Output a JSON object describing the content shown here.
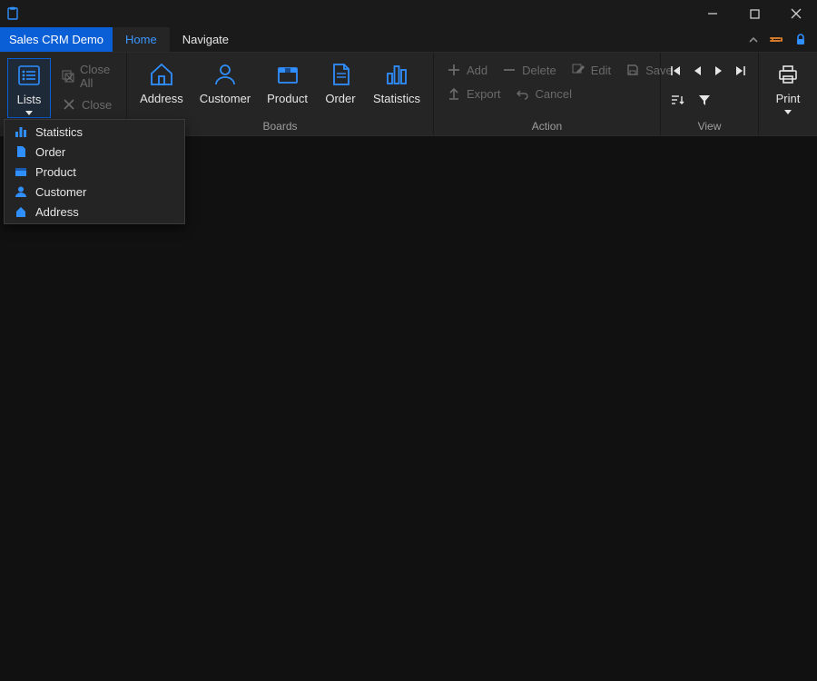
{
  "app": {
    "title": "Sales CRM Demo"
  },
  "tabs": {
    "home": "Home",
    "navigate": "Navigate"
  },
  "ribbon": {
    "lists": {
      "label": "Lists",
      "close_all": "Close All",
      "close": "Close"
    },
    "boards": {
      "group_label": "Boards",
      "address": "Address",
      "customer": "Customer",
      "product": "Product",
      "order": "Order",
      "statistics": "Statistics"
    },
    "action": {
      "group_label": "Action",
      "add": "Add",
      "delete": "Delete",
      "edit": "Edit",
      "save": "Save",
      "export": "Export",
      "cancel": "Cancel"
    },
    "view": {
      "group_label": "View"
    },
    "print": {
      "label": "Print"
    }
  },
  "dropdown": {
    "items": [
      {
        "label": "Statistics",
        "icon": "chart-bar-icon"
      },
      {
        "label": "Order",
        "icon": "file-icon"
      },
      {
        "label": "Product",
        "icon": "box-icon"
      },
      {
        "label": "Customer",
        "icon": "person-icon"
      },
      {
        "label": "Address",
        "icon": "home-icon"
      }
    ]
  },
  "colors": {
    "accent": "#2f8fff",
    "accent_dark": "#0a5fd6",
    "orange": "#d67a2a"
  }
}
